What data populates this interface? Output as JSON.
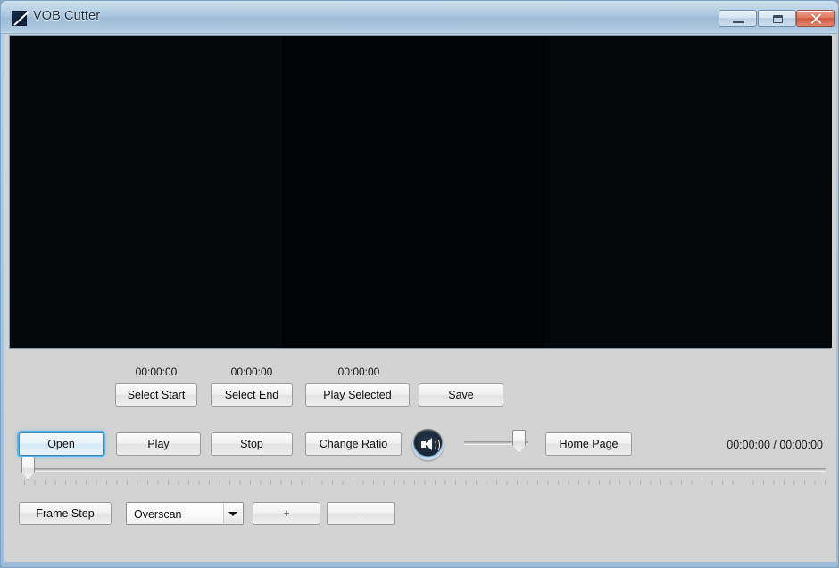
{
  "window": {
    "title": "VOB Cutter",
    "icon": "app-icon",
    "caption_buttons": {
      "minimize": "minimize-icon",
      "maximize": "maximize-icon",
      "close": "close-icon"
    }
  },
  "video": {
    "content": ""
  },
  "markers": {
    "start_time": "00:00:00",
    "end_time": "00:00:00",
    "selection_time": "00:00:00",
    "select_start_label": "Select Start",
    "select_end_label": "Select End",
    "play_selected_label": "Play Selected",
    "save_label": "Save"
  },
  "transport": {
    "open_label": "Open",
    "play_label": "Play",
    "stop_label": "Stop",
    "change_ratio_label": "Change Ratio",
    "home_page_label": "Home Page",
    "volume_icon": "speaker-icon",
    "volume_value": 90,
    "position_total": "00:00:00 / 00:00:00"
  },
  "seek": {
    "position": 0
  },
  "bottom": {
    "frame_step_label": "Frame Step",
    "overscan_selected": "Overscan",
    "overscan_options": [
      "Overscan"
    ],
    "plus_label": "+",
    "minus_label": "-"
  },
  "colors": {
    "accent": "#4dafe8",
    "frame": "#9cbcd8",
    "panel": "#d3d3d3",
    "video": "#000000",
    "close_button": "#cf5a40"
  }
}
